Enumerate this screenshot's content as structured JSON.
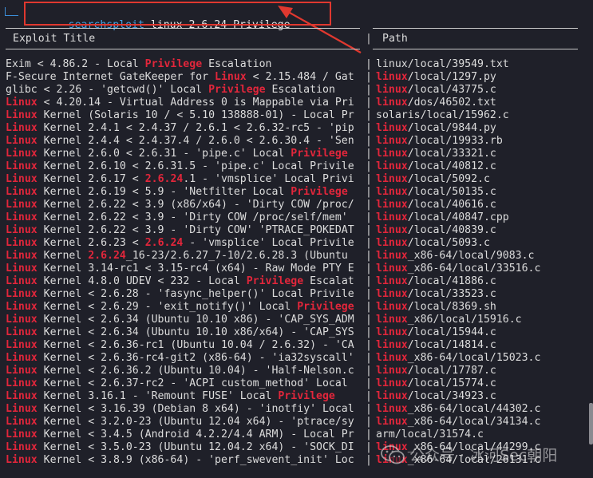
{
  "prompt": {
    "command": "searchsploit",
    "args": " linux 2.6.24 Privilege"
  },
  "table": {
    "header_title": "Exploit Title",
    "header_path": "Path",
    "separator": "|"
  },
  "results": [
    {
      "title": [
        [
          "",
          "Exim < 4.86.2 - Local "
        ],
        [
          "hl",
          "Privilege"
        ],
        [
          "",
          " Escalation"
        ]
      ],
      "path": [
        [
          "",
          "linux/local/39549.txt"
        ]
      ]
    },
    {
      "title": [
        [
          "",
          "F-Secure Internet GateKeeper for "
        ],
        [
          "hl",
          "Linux"
        ],
        [
          "",
          " < 2.15.484 / Gat"
        ]
      ],
      "path": [
        [
          "hl",
          "linux"
        ],
        [
          "",
          "/local/1297.py"
        ]
      ]
    },
    {
      "title": [
        [
          "",
          "glibc < 2.26 - 'getcwd()' Local "
        ],
        [
          "hl",
          "Privilege"
        ],
        [
          "",
          " Escalation"
        ]
      ],
      "path": [
        [
          "hl",
          "linux"
        ],
        [
          "",
          "/local/43775.c"
        ]
      ]
    },
    {
      "title": [
        [
          "hl",
          "Linux"
        ],
        [
          "",
          " < 4.20.14 - Virtual Address 0 is Mappable via Pri"
        ]
      ],
      "path": [
        [
          "hl",
          "linux"
        ],
        [
          "",
          "/dos/46502.txt"
        ]
      ]
    },
    {
      "title": [
        [
          "hl",
          "Linux"
        ],
        [
          "",
          " Kernel (Solaris 10 / < 5.10 138888-01) - Local Pr"
        ]
      ],
      "path": [
        [
          "",
          "solaris/local/15962.c"
        ]
      ]
    },
    {
      "title": [
        [
          "hl",
          "Linux"
        ],
        [
          "",
          " Kernel 2.4.1 < 2.4.37 / 2.6.1 < 2.6.32-rc5 - 'pip"
        ]
      ],
      "path": [
        [
          "hl",
          "linux"
        ],
        [
          "",
          "/local/9844.py"
        ]
      ]
    },
    {
      "title": [
        [
          "hl",
          "Linux"
        ],
        [
          "",
          " Kernel 2.4.4 < 2.4.37.4 / 2.6.0 < 2.6.30.4 - 'Sen"
        ]
      ],
      "path": [
        [
          "hl",
          "linux"
        ],
        [
          "",
          "/local/19933.rb"
        ]
      ]
    },
    {
      "title": [
        [
          "hl",
          "Linux"
        ],
        [
          "",
          " Kernel 2.6.0 < 2.6.31 - 'pipe.c' Local "
        ],
        [
          "hl",
          "Privilege"
        ]
      ],
      "path": [
        [
          "hl",
          "linux"
        ],
        [
          "",
          "/local/33321.c"
        ]
      ]
    },
    {
      "title": [
        [
          "hl",
          "Linux"
        ],
        [
          "",
          " Kernel 2.6.10 < 2.6.31.5 - 'pipe.c' Local Privile"
        ]
      ],
      "path": [
        [
          "hl",
          "linux"
        ],
        [
          "",
          "/local/40812.c"
        ]
      ]
    },
    {
      "title": [
        [
          "hl",
          "Linux"
        ],
        [
          "",
          " Kernel 2.6.17 < "
        ],
        [
          "hl",
          "2.6.24"
        ],
        [
          "",
          ".1 - 'vmsplice' Local Privi"
        ]
      ],
      "path": [
        [
          "hl",
          "linux"
        ],
        [
          "",
          "/local/5092.c"
        ]
      ]
    },
    {
      "title": [
        [
          "hl",
          "Linux"
        ],
        [
          "",
          " Kernel 2.6.19 < 5.9 - 'Netfilter Local "
        ],
        [
          "hl",
          "Privilege"
        ]
      ],
      "path": [
        [
          "hl",
          "linux"
        ],
        [
          "",
          "/local/50135.c"
        ]
      ]
    },
    {
      "title": [
        [
          "hl",
          "Linux"
        ],
        [
          "",
          " Kernel 2.6.22 < 3.9 (x86/x64) - 'Dirty COW /proc/"
        ]
      ],
      "path": [
        [
          "hl",
          "linux"
        ],
        [
          "",
          "/local/40616.c"
        ]
      ]
    },
    {
      "title": [
        [
          "hl",
          "Linux"
        ],
        [
          "",
          " Kernel 2.6.22 < 3.9 - 'Dirty COW /proc/self/mem'"
        ]
      ],
      "path": [
        [
          "hl",
          "linux"
        ],
        [
          "",
          "/local/40847.cpp"
        ]
      ]
    },
    {
      "title": [
        [
          "hl",
          "Linux"
        ],
        [
          "",
          " Kernel 2.6.22 < 3.9 - 'Dirty COW' 'PTRACE_POKEDAT"
        ]
      ],
      "path": [
        [
          "hl",
          "linux"
        ],
        [
          "",
          "/local/40839.c"
        ]
      ]
    },
    {
      "title": [
        [
          "hl",
          "Linux"
        ],
        [
          "",
          " Kernel 2.6.23 < "
        ],
        [
          "hl",
          "2.6.24"
        ],
        [
          "",
          " - 'vmsplice' Local Privile"
        ]
      ],
      "path": [
        [
          "hl",
          "linux"
        ],
        [
          "",
          "/local/5093.c"
        ]
      ]
    },
    {
      "title": [
        [
          "hl",
          "Linux"
        ],
        [
          "",
          " Kernel "
        ],
        [
          "hl",
          "2.6.24"
        ],
        [
          "",
          "_16-23/2.6.27_7-10/2.6.28.3 (Ubuntu"
        ]
      ],
      "path": [
        [
          "hl",
          "linux"
        ],
        [
          "",
          "_x86-64/local/9083.c"
        ]
      ]
    },
    {
      "title": [
        [
          "hl",
          "Linux"
        ],
        [
          "",
          " Kernel 3.14-rc1 < 3.15-rc4 (x64) - Raw Mode PTY E"
        ]
      ],
      "path": [
        [
          "hl",
          "linux"
        ],
        [
          "",
          "_x86-64/local/33516.c"
        ]
      ]
    },
    {
      "title": [
        [
          "hl",
          "Linux"
        ],
        [
          "",
          " Kernel 4.8.0 UDEV < 232 - Local "
        ],
        [
          "hl",
          "Privilege"
        ],
        [
          "",
          " Escalat"
        ]
      ],
      "path": [
        [
          "hl",
          "linux"
        ],
        [
          "",
          "/local/41886.c"
        ]
      ]
    },
    {
      "title": [
        [
          "hl",
          "Linux"
        ],
        [
          "",
          " Kernel < 2.6.28 - 'fasync_helper()' Local Privile"
        ]
      ],
      "path": [
        [
          "hl",
          "linux"
        ],
        [
          "",
          "/local/33523.c"
        ]
      ]
    },
    {
      "title": [
        [
          "hl",
          "Linux"
        ],
        [
          "",
          " Kernel < 2.6.29 - 'exit_notify()' Local "
        ],
        [
          "hl",
          "Privilege"
        ]
      ],
      "path": [
        [
          "hl",
          "linux"
        ],
        [
          "",
          "/local/8369.sh"
        ]
      ]
    },
    {
      "title": [
        [
          "hl",
          "Linux"
        ],
        [
          "",
          " Kernel < 2.6.34 (Ubuntu 10.10 x86) - 'CAP_SYS_ADM"
        ]
      ],
      "path": [
        [
          "hl",
          "linux"
        ],
        [
          "",
          "_x86/local/15916.c"
        ]
      ]
    },
    {
      "title": [
        [
          "hl",
          "Linux"
        ],
        [
          "",
          " Kernel < 2.6.34 (Ubuntu 10.10 x86/x64) - 'CAP_SYS"
        ]
      ],
      "path": [
        [
          "hl",
          "linux"
        ],
        [
          "",
          "/local/15944.c"
        ]
      ]
    },
    {
      "title": [
        [
          "hl",
          "Linux"
        ],
        [
          "",
          " Kernel < 2.6.36-rc1 (Ubuntu 10.04 / 2.6.32) - 'CA"
        ]
      ],
      "path": [
        [
          "hl",
          "linux"
        ],
        [
          "",
          "/local/14814.c"
        ]
      ]
    },
    {
      "title": [
        [
          "hl",
          "Linux"
        ],
        [
          "",
          " Kernel < 2.6.36-rc4-git2 (x86-64) - 'ia32syscall'"
        ]
      ],
      "path": [
        [
          "hl",
          "linux"
        ],
        [
          "",
          "_x86-64/local/15023.c"
        ]
      ]
    },
    {
      "title": [
        [
          "hl",
          "Linux"
        ],
        [
          "",
          " Kernel < 2.6.36.2 (Ubuntu 10.04) - 'Half-Nelson.c"
        ]
      ],
      "path": [
        [
          "hl",
          "linux"
        ],
        [
          "",
          "/local/17787.c"
        ]
      ]
    },
    {
      "title": [
        [
          "hl",
          "Linux"
        ],
        [
          "",
          " Kernel < 2.6.37-rc2 - 'ACPI custom_method' Local"
        ]
      ],
      "path": [
        [
          "hl",
          "linux"
        ],
        [
          "",
          "/local/15774.c"
        ]
      ]
    },
    {
      "title": [
        [
          "hl",
          "Linux"
        ],
        [
          "",
          " Kernel 3.16.1 - 'Remount FUSE' Local "
        ],
        [
          "hl",
          "Privilege"
        ]
      ],
      "path": [
        [
          "hl",
          "linux"
        ],
        [
          "",
          "/local/34923.c"
        ]
      ]
    },
    {
      "title": [
        [
          "hl",
          "Linux"
        ],
        [
          "",
          " Kernel < 3.16.39 (Debian 8 x64) - 'inotfiy' Local"
        ]
      ],
      "path": [
        [
          "hl",
          "linux"
        ],
        [
          "",
          "_x86-64/local/44302.c"
        ]
      ]
    },
    {
      "title": [
        [
          "hl",
          "Linux"
        ],
        [
          "",
          " Kernel < 3.2.0-23 (Ubuntu 12.04 x64) - 'ptrace/sy"
        ]
      ],
      "path": [
        [
          "hl",
          "linux"
        ],
        [
          "",
          "_x86-64/local/34134.c"
        ]
      ]
    },
    {
      "title": [
        [
          "hl",
          "Linux"
        ],
        [
          "",
          " Kernel < 3.4.5 (Android 4.2.2/4.4 ARM) - Local Pr"
        ]
      ],
      "path": [
        [
          "",
          "arm/local/31574.c"
        ]
      ]
    },
    {
      "title": [
        [
          "hl",
          "Linux"
        ],
        [
          "",
          " Kernel < 3.5.0-23 (Ubuntu 12.04.2 x64) - 'SOCK_DI"
        ]
      ],
      "path": [
        [
          "hl",
          "linux"
        ],
        [
          "",
          "_x86-64/local/44299.c"
        ]
      ]
    },
    {
      "title": [
        [
          "hl",
          "Linux"
        ],
        [
          "",
          " Kernel < 3.8.9 (x86-64) - 'perf_swevent_init' Loc"
        ]
      ],
      "path": [
        [
          "hl",
          "linux"
        ],
        [
          "",
          "_x86-64/local/26131.c"
        ]
      ]
    }
  ],
  "watermark": {
    "text": "公众号 · 冰河Sec朝阳"
  },
  "colors": {
    "background": "#1f2029",
    "highlight": "#e2263b",
    "command": "#45a2e6",
    "annotation": "#e0382f"
  }
}
